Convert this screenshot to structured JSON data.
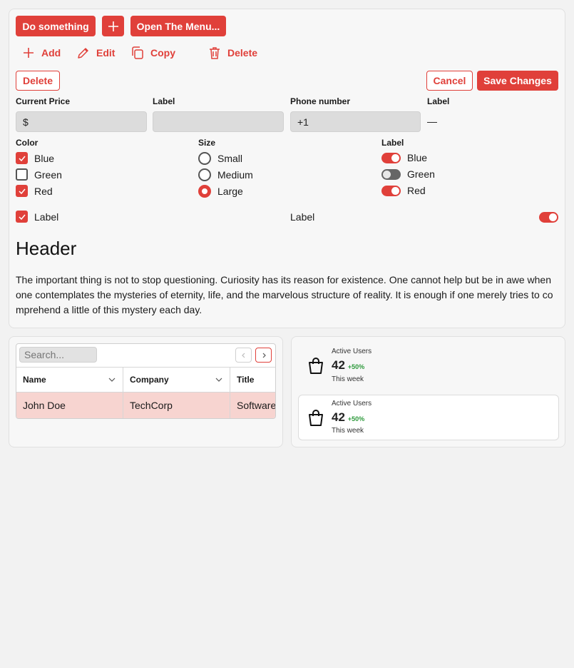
{
  "toolbar": {
    "do_something": "Do something",
    "open_menu": "Open The Menu...",
    "add": "Add",
    "edit": "Edit",
    "copy": "Copy",
    "delete": "Delete"
  },
  "actions": {
    "delete": "Delete",
    "cancel": "Cancel",
    "save": "Save Changes"
  },
  "fields": {
    "price_label": "Current Price",
    "price_prefix": "$",
    "label1": "Label",
    "phone_label": "Phone number",
    "phone_value": "+1",
    "label2": "Label",
    "label2_value": "—"
  },
  "color_group": {
    "label": "Color",
    "options": [
      "Blue",
      "Green",
      "Red"
    ],
    "checked": [
      true,
      false,
      true
    ]
  },
  "size_group": {
    "label": "Size",
    "options": [
      "Small",
      "Medium",
      "Large"
    ],
    "selected": "Large"
  },
  "switch_group": {
    "label": "Label",
    "options": [
      "Blue",
      "Green",
      "Red"
    ],
    "on": [
      true,
      false,
      true
    ]
  },
  "single": {
    "checkbox_label": "Label",
    "switch_label": "Label"
  },
  "content": {
    "header": "Header",
    "paragraph": "The important thing is not to stop questioning. Curiosity has its reason for existence. One cannot help but be in awe when one contemplates the mysteries of eternity, life, and the marvelous structure of reality. It is enough if one merely tries to comprehend a little of this mystery each day."
  },
  "table": {
    "search_placeholder": "Search...",
    "columns": [
      "Name",
      "Company",
      "Title"
    ],
    "rows": [
      [
        "John Doe",
        "TechCorp",
        "Software"
      ]
    ]
  },
  "stats": [
    {
      "title": "Active Users",
      "value": "42",
      "delta": "+50%",
      "period": "This week"
    },
    {
      "title": "Active Users",
      "value": "42",
      "delta": "+50%",
      "period": "This week"
    }
  ],
  "colors": {
    "accent": "#e0403a",
    "positive": "#2e9a3c"
  }
}
